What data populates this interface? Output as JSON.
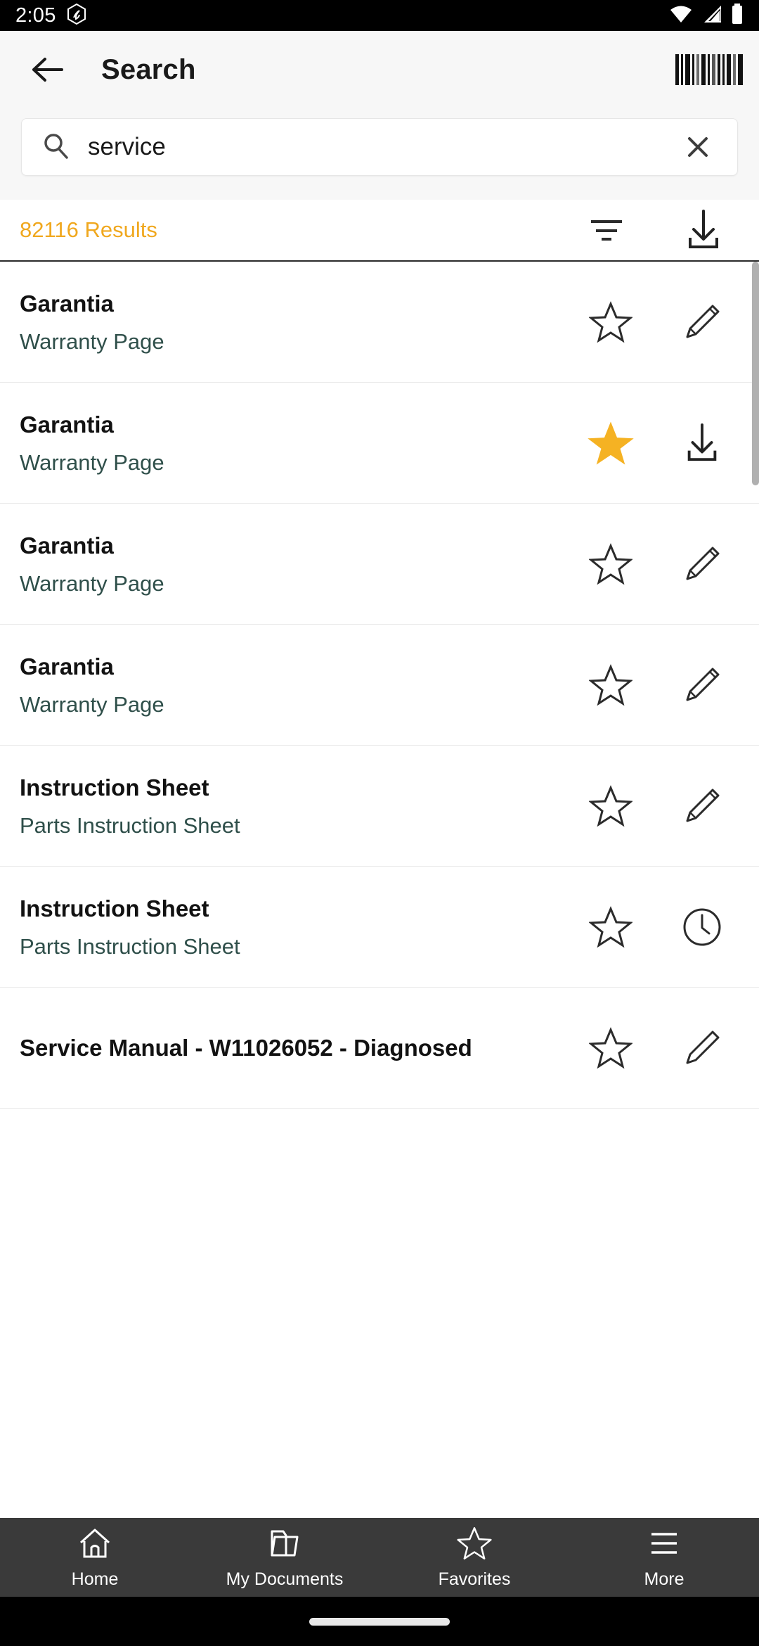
{
  "status_bar": {
    "time": "2:05",
    "app_badge_icon": "hexagon-app-icon",
    "wifi_icon": "wifi-icon",
    "signal_icon": "cellular-signal-icon",
    "battery_icon": "battery-icon"
  },
  "header": {
    "back_icon": "back-arrow-icon",
    "title": "Search",
    "barcode_icon": "barcode-scanner-icon"
  },
  "search": {
    "icon": "search-icon",
    "value": "service",
    "placeholder": "Search",
    "clear_icon": "close-icon"
  },
  "results_bar": {
    "count_label": "82116 Results",
    "count_color": "#f0a81f",
    "filter_icon": "filter-icon",
    "download_icon": "download-icon"
  },
  "colors": {
    "accent_amber": "#f0a81f",
    "star_filled": "#f5b223",
    "subtitle_green": "#2f4f4a",
    "header_bg": "#f7f7f7",
    "nav_bg": "#3a3a3a"
  },
  "results": [
    {
      "title": "Garantia",
      "subtitle": "Warranty Page",
      "star": "star-outline-icon",
      "starred": false,
      "action": "edit-pencil-icon"
    },
    {
      "title": "Garantia",
      "subtitle": "Warranty Page",
      "star": "star-filled-icon",
      "starred": true,
      "action": "download-icon"
    },
    {
      "title": "Garantia",
      "subtitle": "Warranty Page",
      "star": "star-outline-icon",
      "starred": false,
      "action": "edit-pencil-icon"
    },
    {
      "title": "Garantia",
      "subtitle": "Warranty Page",
      "star": "star-outline-icon",
      "starred": false,
      "action": "edit-pencil-icon"
    },
    {
      "title": "Instruction Sheet",
      "subtitle": "Parts Instruction Sheet",
      "star": "star-outline-icon",
      "starred": false,
      "action": "edit-pencil-icon"
    },
    {
      "title": "Instruction Sheet",
      "subtitle": "Parts Instruction Sheet",
      "star": "star-outline-icon",
      "starred": false,
      "action": "clock-icon"
    },
    {
      "title": "Service Manual - W11026052 - Diagnosed",
      "subtitle": "",
      "star": "star-outline-icon",
      "starred": false,
      "action": "edit-pencil-icon"
    }
  ],
  "bottom_nav": [
    {
      "label": "Home",
      "icon": "home-icon"
    },
    {
      "label": "My Documents",
      "icon": "folder-icon"
    },
    {
      "label": "Favorites",
      "icon": "star-outline-icon"
    },
    {
      "label": "More",
      "icon": "hamburger-menu-icon"
    }
  ]
}
